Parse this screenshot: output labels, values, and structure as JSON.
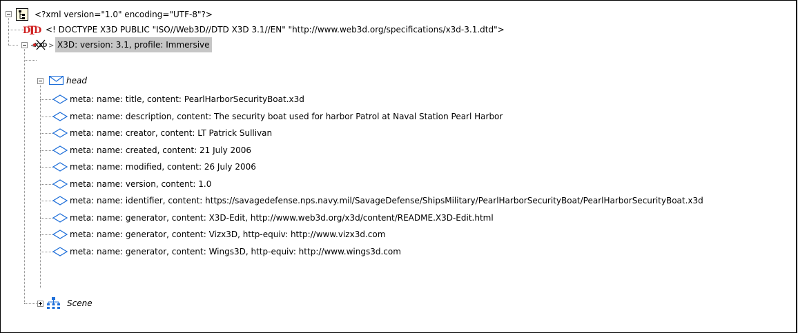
{
  "tree": {
    "root": {
      "label": "<?xml version=\"1.0\" encoding=\"UTF-8\"?>",
      "icon": "document-tree-icon"
    },
    "doctype": {
      "label": "<! DOCTYPE X3D PUBLIC \"ISO//Web3D//DTD X3D 3.1//EN\"  \"http://www.web3d.org/specifications/x3d-3.1.dtd\">",
      "icon": "dtd-icon",
      "icon_text": "DTD"
    },
    "x3d": {
      "label": "X3D:  version: 3.1,  profile: Immersive",
      "icon": "x3d-element-icon",
      "icon_text": "X3D"
    },
    "head": {
      "label": "head",
      "icon": "envelope-icon"
    },
    "meta": [
      "meta:  name: title,  content: PearlHarborSecurityBoat.x3d",
      "meta:  name: description,  content: The security boat used for harbor Patrol at Naval Station Pearl Harbor",
      "meta:  name: creator,  content: LT Patrick Sullivan",
      "meta:  name: created,  content: 21 July 2006",
      "meta:  name: modified,  content: 26 July 2006",
      "meta:  name: version,  content: 1.0",
      "meta:  name: identifier,  content: https://savagedefense.nps.navy.mil/SavageDefense/ShipsMilitary/PearlHarborSecurityBoat/PearlHarborSecurityBoat.x3d",
      "meta:  name: generator,  content: X3D-Edit, http://www.web3d.org/x3d/content/README.X3D-Edit.html",
      "meta:  name: generator,  content: Vizx3D,  http-equiv: http://www.vizx3d.com",
      "meta:  name: generator,  content: Wings3D,  http-equiv: http://www.wings3d.com"
    ],
    "scene": {
      "label": "Scene",
      "icon": "scene-graph-icon"
    }
  },
  "colors": {
    "selection": "#c6c6c6",
    "icon_blue": "#1e6fd9",
    "dtd_red": "#d02020"
  }
}
